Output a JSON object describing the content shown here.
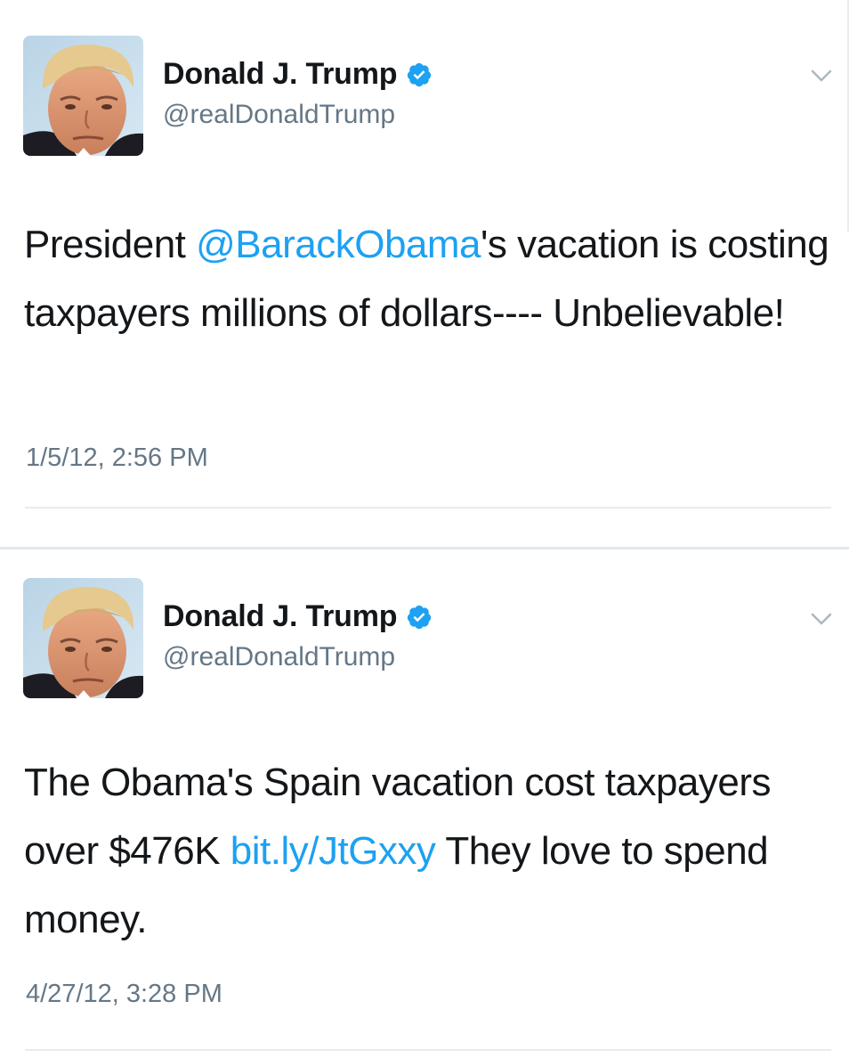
{
  "tweets": [
    {
      "display_name": "Donald J. Trump",
      "handle": "@realDonaldTrump",
      "text_before": "President ",
      "mention": "@BarackObama",
      "text_after": "'s vacation is costing taxpayers millions of dollars---- Unbelievable!",
      "timestamp": "1/5/12, 2:56 PM"
    },
    {
      "display_name": "Donald J. Trump",
      "handle": "@realDonaldTrump",
      "text_before": "The Obama's Spain vacation cost taxpayers over $476K ",
      "link": "bit.ly/JtGxxy",
      "text_after": " They love to spend money.",
      "timestamp": "4/27/12, 3:28 PM"
    }
  ],
  "icons": {
    "verified": "verified-badge-icon",
    "menu": "chevron-down-icon",
    "avatar": "profile-photo"
  },
  "colors": {
    "link": "#1da1f2",
    "secondary_text": "#657786",
    "primary_text": "#14171a",
    "verified": "#1da1f2"
  }
}
